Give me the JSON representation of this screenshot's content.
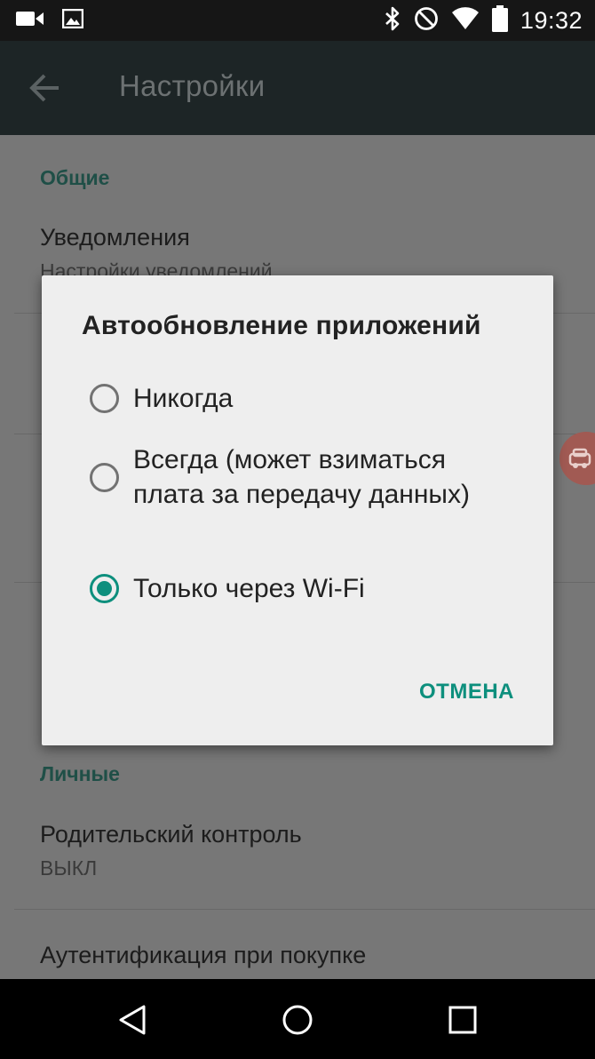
{
  "status_bar": {
    "time": "19:32",
    "left_icons": [
      "video-camera-icon",
      "image-icon"
    ],
    "right_icons": [
      "bluetooth-icon",
      "do-not-disturb-icon",
      "wifi-icon",
      "battery-icon"
    ]
  },
  "toolbar": {
    "title": "Настройки",
    "back_icon": "arrow-left-icon"
  },
  "settings": {
    "section_general": "Общие",
    "notifications_title": "Уведомления",
    "notifications_sub": "Настройки уведомлений",
    "section_personal": "Личные",
    "parental_title": "Родительский контроль",
    "parental_sub": "ВЫКЛ",
    "purchase_auth_title": "Аутентификация при покупке"
  },
  "dialog": {
    "title": "Автообновление приложений",
    "options": [
      {
        "label": "Никогда",
        "checked": false
      },
      {
        "label": "Всегда (может взиматься плата за передачу данных)",
        "checked": false
      },
      {
        "label": "Только через Wi-Fi",
        "checked": true
      }
    ],
    "cancel_label": "ОТМЕНА"
  },
  "colors": {
    "accent": "#0d8f7d",
    "toolbar": "#1d2526",
    "dialog_bg": "#eeeeee"
  },
  "nav_bar": {
    "buttons": [
      "back-triangle-icon",
      "home-circle-icon",
      "recents-square-icon"
    ]
  }
}
